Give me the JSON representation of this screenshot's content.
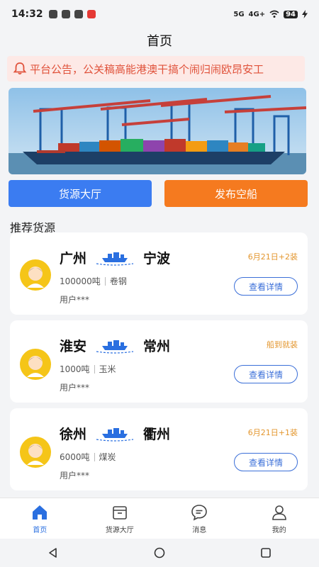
{
  "status_bar": {
    "time": "14:32",
    "network": "5G",
    "network2": "4G+",
    "battery": "94"
  },
  "header": {
    "title": "首页"
  },
  "notice": {
    "text": "平台公告，公关稿高能港澳干搞个闹归闹欧昂安工"
  },
  "actions": {
    "cargo_hall": "货源大厅",
    "publish_ship": "发布空船"
  },
  "section": {
    "title": "推荐货源"
  },
  "listings": [
    {
      "from": "广州",
      "to": "宁波",
      "date_tag": "6月21日+2装",
      "tonnage": "100000吨",
      "cargo": "卷钢",
      "user": "用户***",
      "detail_label": "查看详情"
    },
    {
      "from": "淮安",
      "to": "常州",
      "date_tag": "船到就装",
      "tonnage": "1000吨",
      "cargo": "玉米",
      "user": "用户***",
      "detail_label": "查看详情"
    },
    {
      "from": "徐州",
      "to": "衢州",
      "date_tag": "6月21日+1装",
      "tonnage": "6000吨",
      "cargo": "煤炭",
      "user": "用户***",
      "detail_label": "查看详情"
    }
  ],
  "bottom_nav": {
    "items": [
      {
        "label": "首页",
        "icon": "home-icon",
        "active": true
      },
      {
        "label": "货源大厅",
        "icon": "box-icon",
        "active": false
      },
      {
        "label": "消息",
        "icon": "message-icon",
        "active": false
      },
      {
        "label": "我的",
        "icon": "user-icon",
        "active": false
      }
    ]
  },
  "colors": {
    "primary_blue": "#3b7cf1",
    "accent_orange": "#f57a1f",
    "notice_red": "#e0523b",
    "tag_orange": "#e3962e"
  }
}
